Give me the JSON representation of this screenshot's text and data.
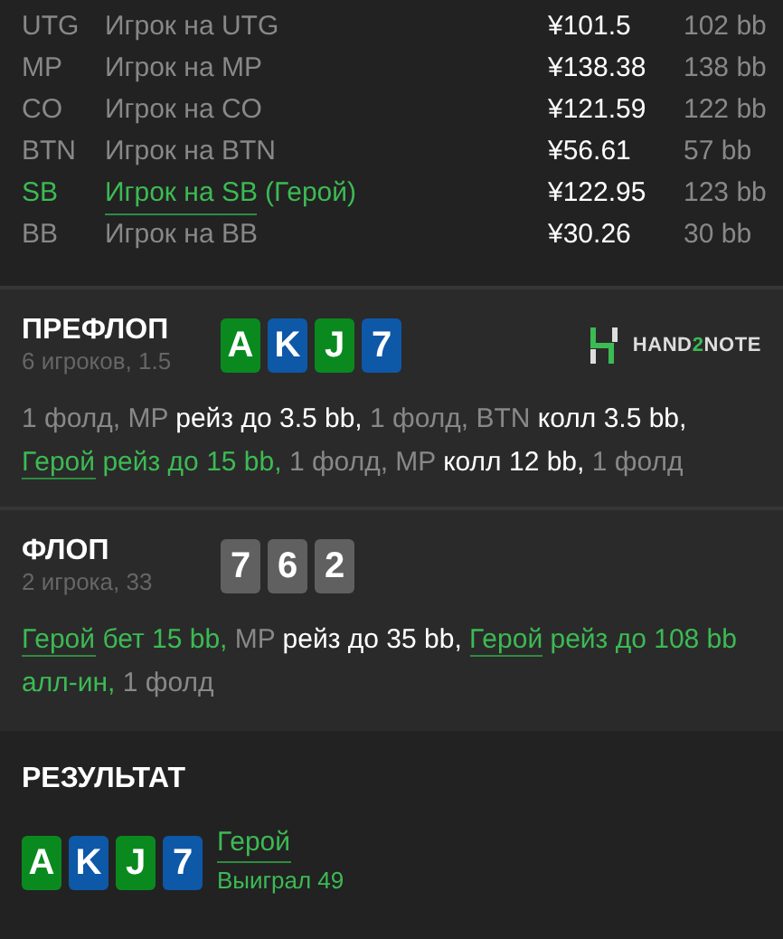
{
  "players": [
    {
      "position": "UTG",
      "name": "Игрок на UTG",
      "stack": "¥101.5",
      "bb": "102 bb",
      "hero": false
    },
    {
      "position": "MP",
      "name": "Игрок на MP",
      "stack": "¥138.38",
      "bb": "138 bb",
      "hero": false
    },
    {
      "position": "CO",
      "name": "Игрок на CO",
      "stack": "¥121.59",
      "bb": "122 bb",
      "hero": false
    },
    {
      "position": "BTN",
      "name": "Игрок на BTN",
      "stack": "¥56.61",
      "bb": "57 bb",
      "hero": false
    },
    {
      "position": "SB",
      "name": "Игрок на SB",
      "hero_tag": "(Герой)",
      "stack": "¥122.95",
      "bb": "123 bb",
      "hero": true
    },
    {
      "position": "BB",
      "name": "Игрок на BB",
      "stack": "¥30.26",
      "bb": "30 bb",
      "hero": false
    }
  ],
  "streets": [
    {
      "title": "ПРЕФЛОП",
      "subtitle": "6 игроков, 1.5",
      "cards": [
        {
          "rank": "A",
          "color": "#0a8a1e"
        },
        {
          "rank": "K",
          "color": "#0e58a8"
        },
        {
          "rank": "J",
          "color": "#0a8a1e"
        },
        {
          "rank": "7",
          "color": "#0e58a8"
        }
      ],
      "logo": [
        {
          "text": "HAND",
          "accent": false
        },
        {
          "text": "2",
          "accent": true
        },
        {
          "text": "NOTE",
          "accent": false
        }
      ],
      "actions": [
        {
          "kind": "muted",
          "text": "1 фолд, MP "
        },
        {
          "kind": "action",
          "text": "рейз до 3.5 bb,"
        },
        {
          "kind": "muted",
          "text": " 1 фолд, BTN "
        },
        {
          "kind": "action",
          "text": "колл 3.5 bb,"
        },
        {
          "kind": "hero",
          "text": "Герой"
        },
        {
          "kind": "hero_action",
          "text": " рейз до 15 bb,"
        },
        {
          "kind": "muted",
          "text": " 1 фолд, MP "
        },
        {
          "kind": "action",
          "text": "колл 12 bb,"
        },
        {
          "kind": "muted",
          "text": " 1 фолд"
        }
      ]
    },
    {
      "title": "ФЛОП",
      "subtitle": "2 игрока, 33",
      "cards": [
        {
          "rank": "7",
          "color": "#606060"
        },
        {
          "rank": "6",
          "color": "#606060"
        },
        {
          "rank": "2",
          "color": "#606060"
        }
      ],
      "actions": [
        {
          "kind": "hero",
          "text": "Герой"
        },
        {
          "kind": "hero_action",
          "text": " бет 15 bb,"
        },
        {
          "kind": "muted",
          "text": " MP "
        },
        {
          "kind": "action",
          "text": "рейз до 35 bb,"
        },
        {
          "kind": "hero",
          "text": "Герой"
        },
        {
          "kind": "hero_action",
          "text": " рейз до 108 bb алл-ин,"
        },
        {
          "kind": "muted",
          "text": " 1 фолд"
        }
      ]
    }
  ],
  "result": {
    "title": "РЕЗУЛЬТАТ",
    "cards": [
      {
        "rank": "A",
        "color": "#0a8a1e"
      },
      {
        "rank": "K",
        "color": "#0e58a8"
      },
      {
        "rank": "J",
        "color": "#0a8a1e"
      },
      {
        "rank": "7",
        "color": "#0e58a8"
      }
    ],
    "winner": "Герой",
    "outcome": "Выиграл 49"
  }
}
